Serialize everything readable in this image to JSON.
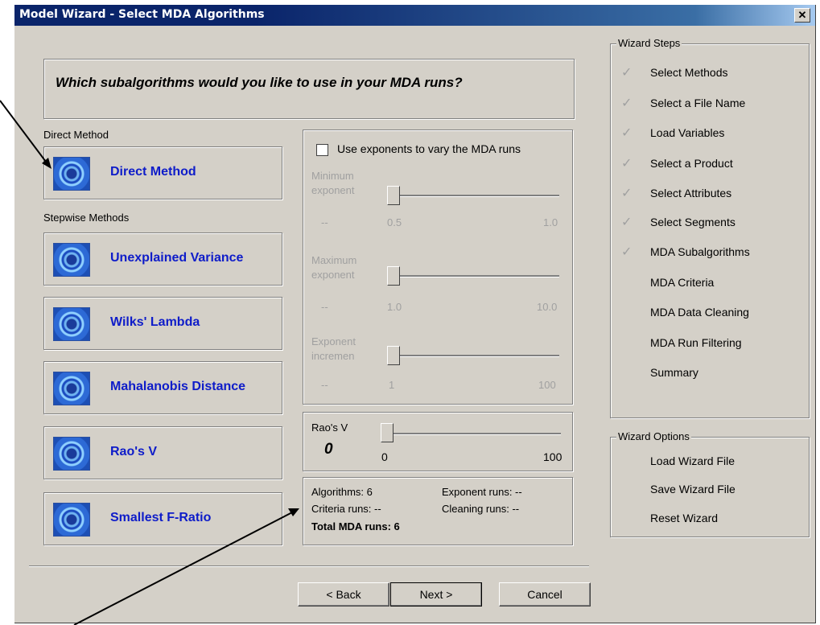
{
  "window": {
    "title": "Model Wizard - Select MDA Algorithms",
    "close_glyph": "✕"
  },
  "question": "Which subalgorithms would you like to use in your MDA runs?",
  "direct_label": "Direct Method",
  "stepwise_label": "Stepwise Methods",
  "methods": [
    "Direct Method",
    "Unexplained Variance",
    "Wilks' Lambda",
    "Mahalanobis Distance",
    "Rao's V",
    "Smallest F-Ratio"
  ],
  "exponents": {
    "checkbox_label": "Use exponents to vary the MDA runs",
    "checked": false,
    "min": {
      "label1": "Minimum",
      "label2": "exponent",
      "value": "--",
      "lo": "0.5",
      "hi": "1.0"
    },
    "max": {
      "label1": "Maximum",
      "label2": "exponent",
      "value": "--",
      "lo": "1.0",
      "hi": "10.0"
    },
    "inc": {
      "label1": "Exponent",
      "label2": "incremen",
      "value": "--",
      "lo": "1",
      "hi": "100"
    }
  },
  "raos": {
    "label": "Rao's V",
    "value": "0",
    "lo": "0",
    "hi": "100"
  },
  "summary": {
    "algorithms": "Algorithms: 6",
    "exponent_runs": "Exponent runs: --",
    "criteria_runs": "Criteria runs: --",
    "cleaning_runs": "Cleaning runs: --",
    "total": "Total MDA runs: 6"
  },
  "buttons": {
    "back": "< Back",
    "next": "Next >",
    "cancel": "Cancel"
  },
  "wizard_steps": {
    "title": "Wizard Steps",
    "check_glyph": "✓",
    "items": [
      {
        "label": "Select Methods",
        "done": true
      },
      {
        "label": "Select a File Name",
        "done": true
      },
      {
        "label": "Load Variables",
        "done": true
      },
      {
        "label": "Select a Product",
        "done": true
      },
      {
        "label": "Select Attributes",
        "done": true
      },
      {
        "label": "Select Segments",
        "done": true
      },
      {
        "label": "MDA Subalgorithms",
        "done": true
      },
      {
        "label": "MDA Criteria",
        "done": false
      },
      {
        "label": "MDA Data Cleaning",
        "done": false
      },
      {
        "label": "MDA Run Filtering",
        "done": false
      },
      {
        "label": "Summary",
        "done": false
      }
    ]
  },
  "wizard_options": {
    "title": "Wizard Options",
    "items": [
      "Load Wizard File",
      "Save Wizard File",
      "Reset Wizard"
    ]
  }
}
